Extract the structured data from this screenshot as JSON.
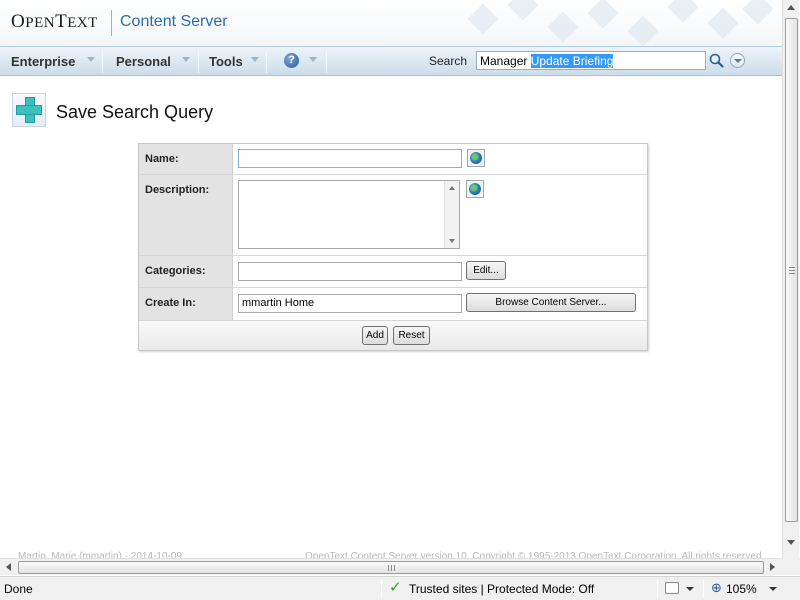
{
  "header": {
    "logo_brand_first": "O",
    "logo_brand_rest_1": "PEN",
    "logo_brand_mid": "T",
    "logo_brand_rest_2": "EXT",
    "product_name": "Content Server"
  },
  "nav": {
    "items": [
      {
        "label": "Enterprise"
      },
      {
        "label": "Personal"
      },
      {
        "label": "Tools"
      }
    ],
    "help_icon": "question-icon",
    "help_glyph": "?"
  },
  "search": {
    "label": "Search",
    "value_plain": "Manager ",
    "value_selected": "Update Briefing"
  },
  "page": {
    "title": "Save Search Query",
    "title_icon": "add-plus-icon"
  },
  "form": {
    "name_label": "Name:",
    "name_value": "",
    "description_label": "Description:",
    "description_value": "",
    "categories_label": "Categories:",
    "categories_value": "",
    "edit_button": "Edit...",
    "create_in_label": "Create In:",
    "create_in_value": "mmartin Home",
    "browse_button": "Browse Content Server...",
    "add_button": "Add",
    "reset_button": "Reset"
  },
  "footer": {
    "left_text": "Martin, Marie (mmartin)  ·  2014-10-09",
    "right_text": "OpenText Content Server version 10. Copyright © 1995-2013 OpenText Corporation. All rights reserved."
  },
  "statusbar": {
    "status": "Done",
    "security_zone": "Trusted sites | Protected Mode: Off",
    "zoom": "105%",
    "check_glyph": "✓",
    "zoom_glyph": "⊕"
  },
  "colors": {
    "accent_blue": "#2a6cb0",
    "nav_gradient_top": "#eef4f9",
    "nav_gradient_bottom": "#cbdcea",
    "selection": "#3399ff",
    "form_label_bg": "#e3e3e3",
    "trusted_check": "#2fa02f"
  }
}
